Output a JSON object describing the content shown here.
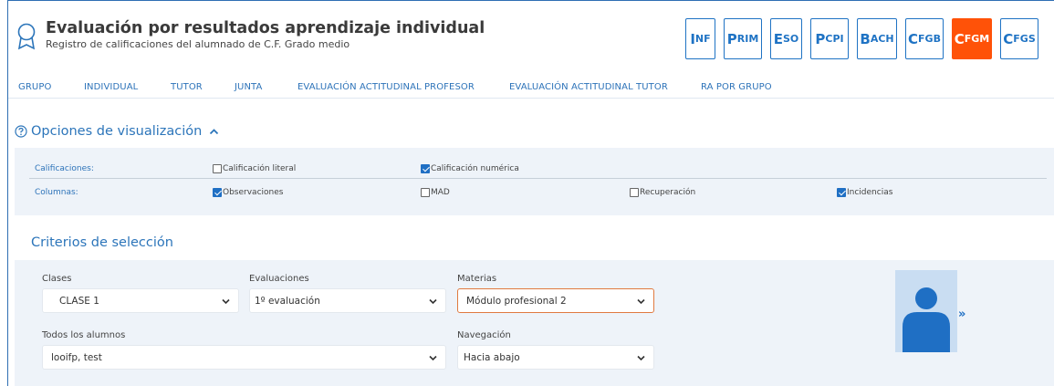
{
  "header": {
    "title": "Evaluación por resultados aprendizaje individual",
    "subtitle": "Registro de calificaciones del alumnado de C.F. Grado medio",
    "levels": [
      {
        "cap": "I",
        "rest": "nf",
        "active": false,
        "width": 33
      },
      {
        "cap": "P",
        "rest": "rim",
        "active": false,
        "width": 42
      },
      {
        "cap": "E",
        "rest": "so",
        "active": false,
        "width": 35
      },
      {
        "cap": "P",
        "rest": "cpi",
        "active": false,
        "width": 42
      },
      {
        "cap": "B",
        "rest": "ach",
        "active": false,
        "width": 44
      },
      {
        "cap": "C",
        "rest": "fgb",
        "active": false,
        "width": 42
      },
      {
        "cap": "C",
        "rest": "fgm",
        "active": true,
        "width": 44
      },
      {
        "cap": "C",
        "rest": "fgs",
        "active": false,
        "width": 42
      }
    ],
    "accent_color": "#1f73c4",
    "active_color": "#ff5208"
  },
  "nav": {
    "items": [
      "GRUPO",
      "INDIVIDUAL",
      "TUTOR",
      "JUNTA",
      "EVALUACIÓN ACTITUDINAL PROFESOR",
      "EVALUACIÓN ACTITUDINAL TUTOR",
      "RA POR GRUPO"
    ]
  },
  "opciones": {
    "title": "Opciones de visualización",
    "row1": {
      "label": "Calificaciones:",
      "options": [
        {
          "label": "Calificación literal",
          "checked": false
        },
        {
          "label": "Calificación numérica",
          "checked": true
        }
      ]
    },
    "row2": {
      "label": "Columnas:",
      "options": [
        {
          "label": "Observaciones",
          "checked": true
        },
        {
          "label": "MAD",
          "checked": false
        },
        {
          "label": "Recuperación",
          "checked": false
        },
        {
          "label": "Incidencias",
          "checked": true
        }
      ]
    }
  },
  "criterios": {
    "title": "Criterios de selección",
    "clases": {
      "label": "Clases",
      "value": "CLASE 1"
    },
    "evaluaciones": {
      "label": "Evaluaciones",
      "value": "1º evaluación"
    },
    "materias": {
      "label": "Materias",
      "value": "Módulo profesional 2"
    },
    "alumnos": {
      "label": "Todos los alumnos",
      "value": "looifp, test"
    },
    "navegacion": {
      "label": "Navegación",
      "value": "Hacia abajo"
    },
    "expand_label": "»"
  }
}
